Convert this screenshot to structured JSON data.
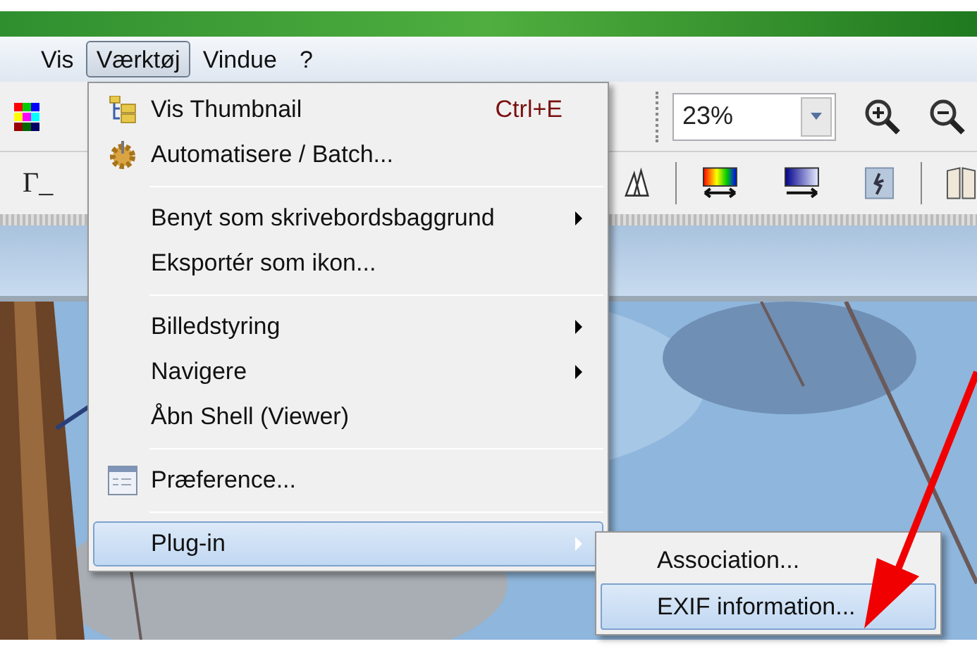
{
  "menubar": [
    {
      "label": "Vis",
      "selected": false
    },
    {
      "label": "Værktøj",
      "selected": true
    },
    {
      "label": "Vindue",
      "selected": false
    },
    {
      "label": "?",
      "selected": false
    }
  ],
  "toolbar": {
    "zoom_field": {
      "value": "23%"
    },
    "tool_glyph": "Γ_"
  },
  "menu": {
    "items": [
      {
        "kind": "item",
        "label": "Vis Thumbnail",
        "shortcut": "Ctrl+E",
        "submenu": false,
        "selected": false
      },
      {
        "kind": "item",
        "label": "Automatisere / Batch...",
        "submenu": false,
        "selected": false
      },
      {
        "kind": "separator"
      },
      {
        "kind": "item",
        "label": "Benyt som skrivebordsbaggrund",
        "submenu": true,
        "selected": false
      },
      {
        "kind": "item",
        "label": "Eksportér som ikon...",
        "submenu": false,
        "selected": false
      },
      {
        "kind": "separator"
      },
      {
        "kind": "item",
        "label": "Billedstyring",
        "submenu": true,
        "selected": false
      },
      {
        "kind": "item",
        "label": "Navigere",
        "submenu": true,
        "selected": false
      },
      {
        "kind": "item",
        "label": "Åbn Shell (Viewer)",
        "submenu": false,
        "selected": false
      },
      {
        "kind": "separator"
      },
      {
        "kind": "item",
        "label": "Præference...",
        "submenu": false,
        "selected": false
      },
      {
        "kind": "separator"
      },
      {
        "kind": "item",
        "label": "Plug-in",
        "submenu": true,
        "selected": true
      }
    ]
  },
  "submenu": {
    "items": [
      {
        "label": "Association...",
        "selected": false
      },
      {
        "label": "EXIF information...",
        "selected": true
      }
    ]
  }
}
